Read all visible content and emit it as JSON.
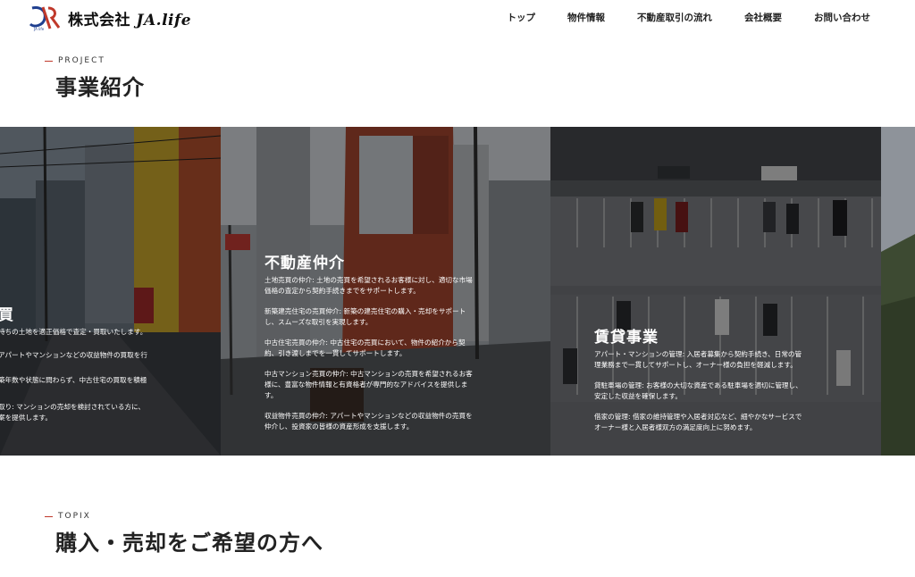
{
  "header": {
    "logo_mark_text": "JA life",
    "company_name_jp": "株式会社",
    "company_name_en": "JA.life",
    "nav": [
      {
        "label": "トップ"
      },
      {
        "label": "物件情報"
      },
      {
        "label": "不動産取引の流れ"
      },
      {
        "label": "会社概要"
      },
      {
        "label": "お問い合わせ"
      }
    ]
  },
  "project": {
    "label": "PROJECT",
    "title": "事業紹介"
  },
  "panels": [
    {
      "title": "買",
      "items": [
        "持ちの土地を適正価格で査定・買取いたします。",
        "アパートやマンションなどの収益物件の買取を行",
        "築年数や状態に問わらず、中古住宅の買取を積極",
        "取り: マンションの売却を検討されている方に、\n案を提供します。"
      ]
    },
    {
      "title": "不動産仲介",
      "items": [
        "土地売買の仲介: 土地の売買を希望されるお客様に対し、適切な市場\n価格の査定から契約手続きまでをサポートします。",
        "新築建売住宅の売買仲介: 新築の建売住宅の購入・売却をサポート\nし、スムーズな取引を実現します。",
        "中古住宅売買の仲介: 中古住宅の売買において、物件の紹介から契\n約、引き渡しまでを一貫してサポートします。",
        "中古マンション売買の仲介: 中古マンションの売買を希望されるお客\n様に、豊富な物件情報と有資格者が専門的なアドバイスを提供しま\nす。",
        "収益物件売買の仲介: アパートやマンションなどの収益物件の売買を\n仲介し、投資家の皆様の資産形成を支援します。"
      ]
    },
    {
      "title": "賃貸事業",
      "items": [
        "アパート・マンションの管理: 入居者募集から契約手続き、日常の管\n理業務まで一貫してサポートし、オーナー様の負担を軽減します。",
        "貸駐車場の管理: お客様の大切な資産である駐車場を適切に管理し、\n安定した収益を確保します。",
        "借家の管理: 借家の維持管理や入居者対応など、細やかなサービスで\nオーナー様と入居者様双方の満足度向上に努めます。"
      ]
    }
  ],
  "topix": {
    "label": "TOPIX",
    "title": "購入・売却をご希望の方へ"
  },
  "colors": {
    "accent": "#c0392b",
    "logo_blue": "#1f3f8f",
    "logo_red": "#c0392b"
  }
}
